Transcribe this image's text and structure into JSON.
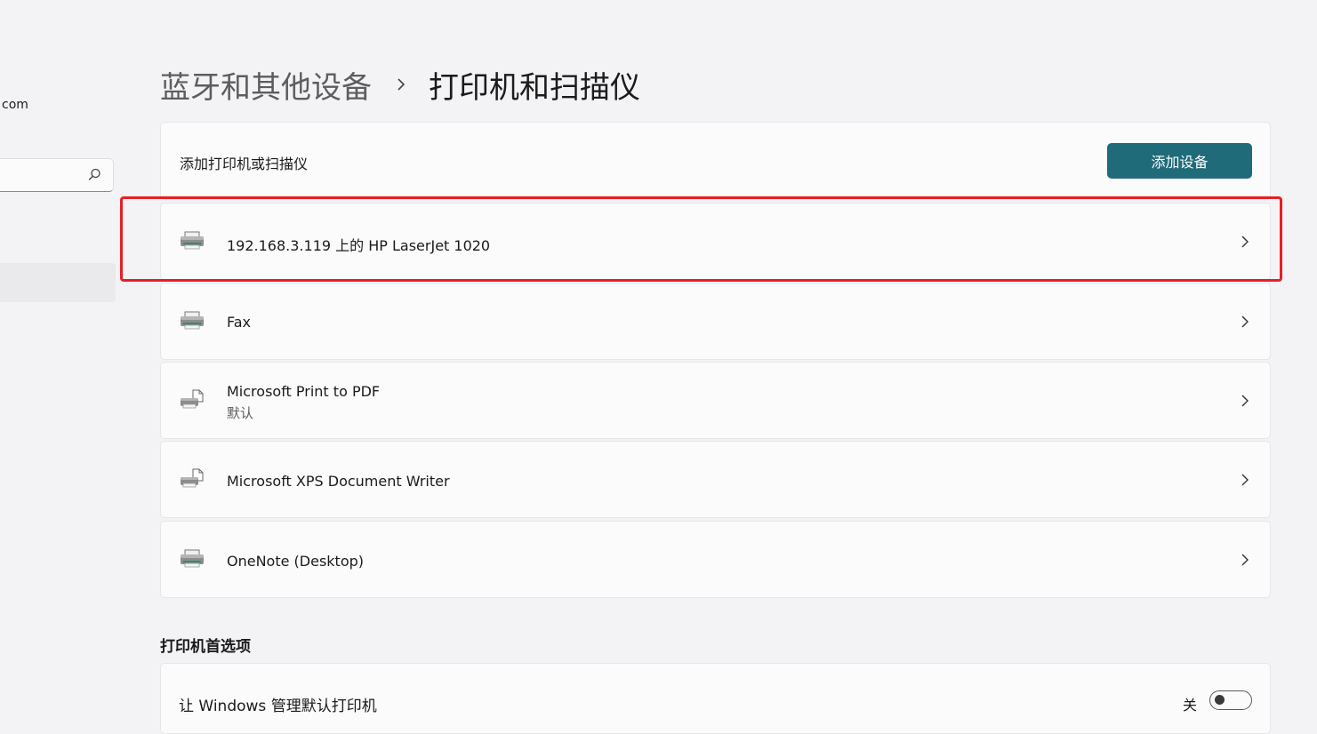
{
  "sidebar": {
    "email_fragment": "com"
  },
  "breadcrumb": {
    "parent": "蓝牙和其他设备",
    "current": "打印机和扫描仪"
  },
  "add_section": {
    "label": "添加打印机或扫描仪",
    "button_label": "添加设备"
  },
  "printers": [
    {
      "name": "192.168.3.119 上的 HP LaserJet 1020",
      "subtitle": "",
      "icon": "printer-icon",
      "highlighted": true
    },
    {
      "name": "Fax",
      "subtitle": "",
      "icon": "printer-icon"
    },
    {
      "name": "Microsoft Print to PDF",
      "subtitle": "默认",
      "icon": "virtual-printer-icon"
    },
    {
      "name": "Microsoft XPS Document Writer",
      "subtitle": "",
      "icon": "virtual-printer-icon"
    },
    {
      "name": "OneNote (Desktop)",
      "subtitle": "",
      "icon": "printer-icon"
    }
  ],
  "preferences": {
    "title": "打印机首选项",
    "manage_default_label": "让 Windows 管理默认打印机",
    "manage_default_state": "关",
    "manage_default_on": false
  },
  "colors": {
    "accent": "#1f6b7a",
    "highlight": "#e81f24"
  }
}
